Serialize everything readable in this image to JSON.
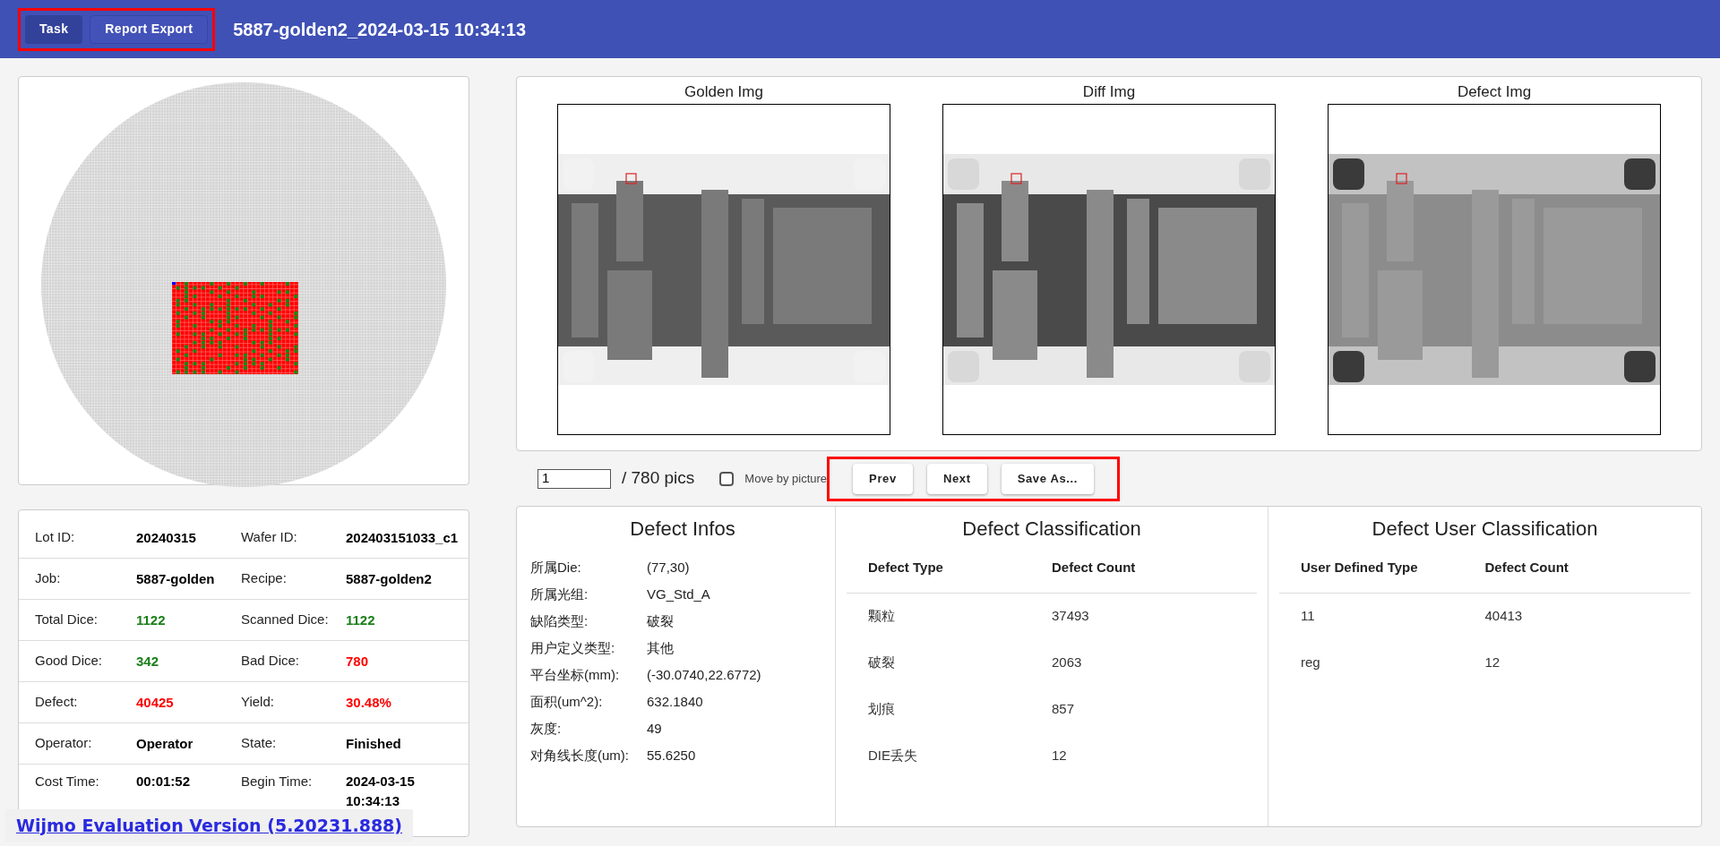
{
  "header": {
    "buttons": [
      {
        "label": "Task",
        "selected": true
      },
      {
        "label": "Report Export",
        "selected": false
      }
    ],
    "title": "5887-golden2_2024-03-15 10:34:13"
  },
  "info_rows": [
    {
      "fields": [
        {
          "label": "Lot ID:",
          "value": "20240315",
          "color": "#000000"
        },
        {
          "label": "Wafer ID:",
          "value": "202403151033_c1",
          "color": "#000000"
        }
      ]
    },
    {
      "fields": [
        {
          "label": "Job:",
          "value": "5887-golden",
          "color": "#000000"
        },
        {
          "label": "Recipe:",
          "value": "5887-golden2",
          "color": "#000000"
        }
      ]
    },
    {
      "fields": [
        {
          "label": "Total Dice:",
          "value": "1122",
          "color": "#1a7f1a"
        },
        {
          "label": "Scanned Dice:",
          "value": "1122",
          "color": "#1a7f1a"
        }
      ]
    },
    {
      "fields": [
        {
          "label": "Good Dice:",
          "value": "342",
          "color": "#1a7f1a"
        },
        {
          "label": "Bad Dice:",
          "value": "780",
          "color": "#ff0000"
        }
      ]
    },
    {
      "fields": [
        {
          "label": "Defect:",
          "value": "40425",
          "color": "#ff0000"
        },
        {
          "label": "Yield:",
          "value": "30.48%",
          "color": "#ff0000"
        }
      ]
    },
    {
      "fields": [
        {
          "label": "Operator:",
          "value": "Operator",
          "color": "#000000"
        },
        {
          "label": "State:",
          "value": "Finished",
          "color": "#000000"
        }
      ]
    },
    {
      "fields": [
        {
          "label": "Cost Time:",
          "value": "00:01:52",
          "color": "#000000"
        },
        {
          "label": "Begin Time:",
          "value": "2024-03-15 10:34:13",
          "color": "#000000"
        }
      ]
    }
  ],
  "images": [
    {
      "title": "Golden Img",
      "kind": "golden"
    },
    {
      "title": "Diff Img",
      "kind": "diff"
    },
    {
      "title": "Defect Img",
      "kind": "defect"
    }
  ],
  "pager": {
    "page": "1",
    "total": "/ 780 pics",
    "move_by_picture": {
      "label": "Move by picture",
      "checked": false
    },
    "buttons": [
      "Prev",
      "Next",
      "Save As..."
    ]
  },
  "defect_infos": {
    "title": "Defect Infos",
    "rows": [
      {
        "label": "所属Die:",
        "value": "(77,30)"
      },
      {
        "label": "所属光组:",
        "value": "VG_Std_A"
      },
      {
        "label": "缺陷类型:",
        "value": "破裂"
      },
      {
        "label": "用户定义类型:",
        "value": "其他"
      },
      {
        "label": "平台坐标(mm):",
        "value": "(-30.0740,22.6772)"
      },
      {
        "label": "面积(um^2):",
        "value": "632.1840"
      },
      {
        "label": "灰度:",
        "value": "49"
      },
      {
        "label": "对角线长度(um):",
        "value": "55.6250"
      }
    ]
  },
  "classification": {
    "title": "Defect Classification",
    "columns": [
      "Defect Type",
      "Defect Count"
    ],
    "rows": [
      [
        "颗粒",
        "37493"
      ],
      [
        "破裂",
        "2063"
      ],
      [
        "划痕",
        "857"
      ],
      [
        "DIE丢失",
        "12"
      ]
    ]
  },
  "user_classification": {
    "title": "Defect User Classification",
    "columns": [
      "User Defined Type",
      "Defect Count"
    ],
    "rows": [
      [
        "11",
        "40413"
      ],
      [
        "reg",
        "12"
      ]
    ]
  },
  "banner": "Wijmo Evaluation Version (5.20231.888)"
}
